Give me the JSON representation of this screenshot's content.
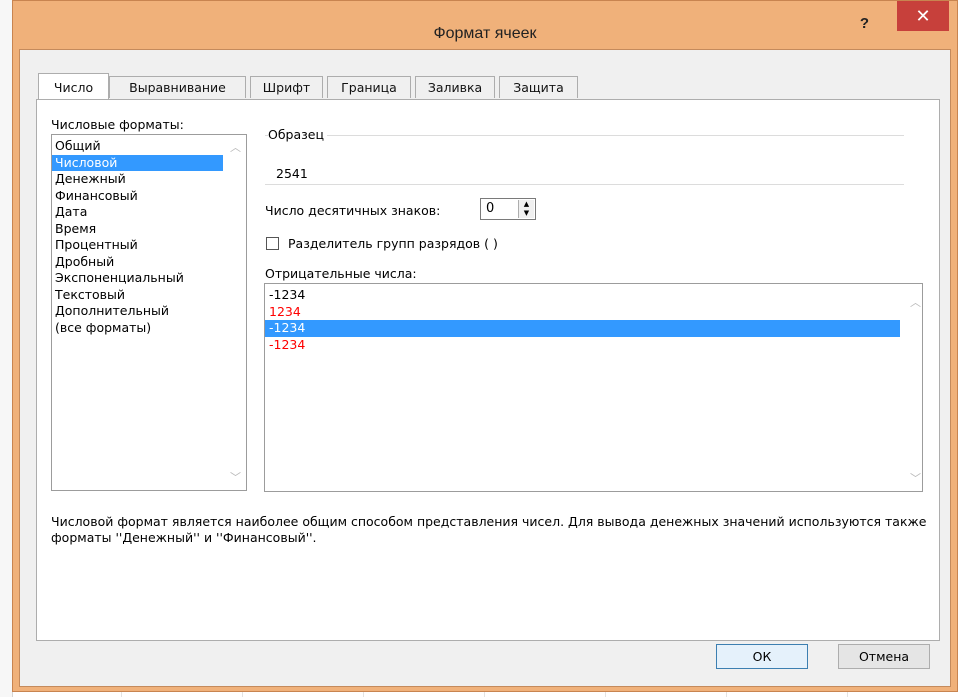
{
  "dialog": {
    "title": "Формат ячеек",
    "help_label": "?",
    "close_label": "✕"
  },
  "tabs": [
    {
      "label": "Число",
      "active": true
    },
    {
      "label": "Выравнивание"
    },
    {
      "label": "Шрифт"
    },
    {
      "label": "Граница"
    },
    {
      "label": "Заливка"
    },
    {
      "label": "Защита"
    }
  ],
  "number_formats": {
    "label": "Числовые форматы:",
    "items": [
      "Общий",
      "Числовой",
      "Денежный",
      "Финансовый",
      "Дата",
      "Время",
      "Процентный",
      "Дробный",
      "Экспоненциальный",
      "Текстовый",
      "Дополнительный",
      "(все форматы)"
    ],
    "selected": "Числовой"
  },
  "sample": {
    "legend": "Образец",
    "value": "2541"
  },
  "decimals": {
    "label": "Число десятичных знаков:",
    "value": "0"
  },
  "thousands_separator": {
    "label": "Разделитель групп разрядов ( )",
    "checked": false
  },
  "negative_numbers": {
    "label": "Отрицательные числа:",
    "items": [
      "-1234",
      "1234",
      "-1234",
      "-1234"
    ],
    "selected_index": 2
  },
  "description": "Числовой формат является наиболее общим способом представления чисел. Для вывода денежных значений используются также форматы ''Денежный'' и ''Финансовый''.",
  "buttons": {
    "ok": "ОК",
    "cancel": "Отмена"
  },
  "colors": {
    "titlebar": "#f0b17a",
    "close_button": "#c7403b",
    "selection": "#3399ff",
    "negative_red": "#ff0000"
  }
}
